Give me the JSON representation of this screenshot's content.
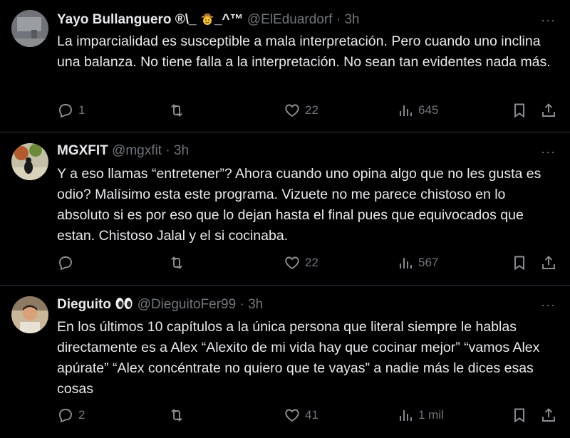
{
  "tweets": [
    {
      "name_a": "Yayo Bullanguero ®\\_",
      "name_b": "_^™",
      "handle": "@ElEduardorf",
      "time": "· 3h",
      "text": "La imparcialidad es susceptible a mala interpretación. Pero cuando uno inclina una balanza. No tiene falla a la interpretación. No sean tan evidentes nada más.",
      "replies": "1",
      "retweets": "",
      "likes": "22",
      "views": "645"
    },
    {
      "name": "MGXFIT",
      "handle": "@mgxfit",
      "time": "· 3h",
      "text": "Y a eso llamas “entretener”? Ahora cuando uno opina algo que no les gusta es odio? Malísimo esta este programa. Vizuete no me parece chistoso en lo absoluto si es por eso que lo dejan hasta el final pues que equivocados que estan.  Chistoso Jalal y el si cocinaba.",
      "replies": "",
      "retweets": "",
      "likes": "22",
      "views": "567"
    },
    {
      "name": "Dieguito",
      "handle": "@DieguitoFer99",
      "time": "· 3h",
      "text": "En los últimos 10 capítulos a la única persona que literal siempre le hablas directamente es a Alex “Alexito de mi vida hay que cocinar mejor” “vamos Alex apúrate” “Alex concéntrate no quiero que te vayas” a nadie más le dices esas cosas",
      "replies": "2",
      "retweets": "",
      "likes": "41",
      "views": "1 mil"
    }
  ],
  "more_icon": "···",
  "icons": [
    "reply-icon",
    "retweet-icon",
    "like-icon",
    "views-icon",
    "bookmark-icon",
    "share-icon"
  ],
  "colors": {
    "background": "#000000",
    "text": "#e7e9ea",
    "secondary": "#71767b",
    "divider": "#2f3336"
  }
}
